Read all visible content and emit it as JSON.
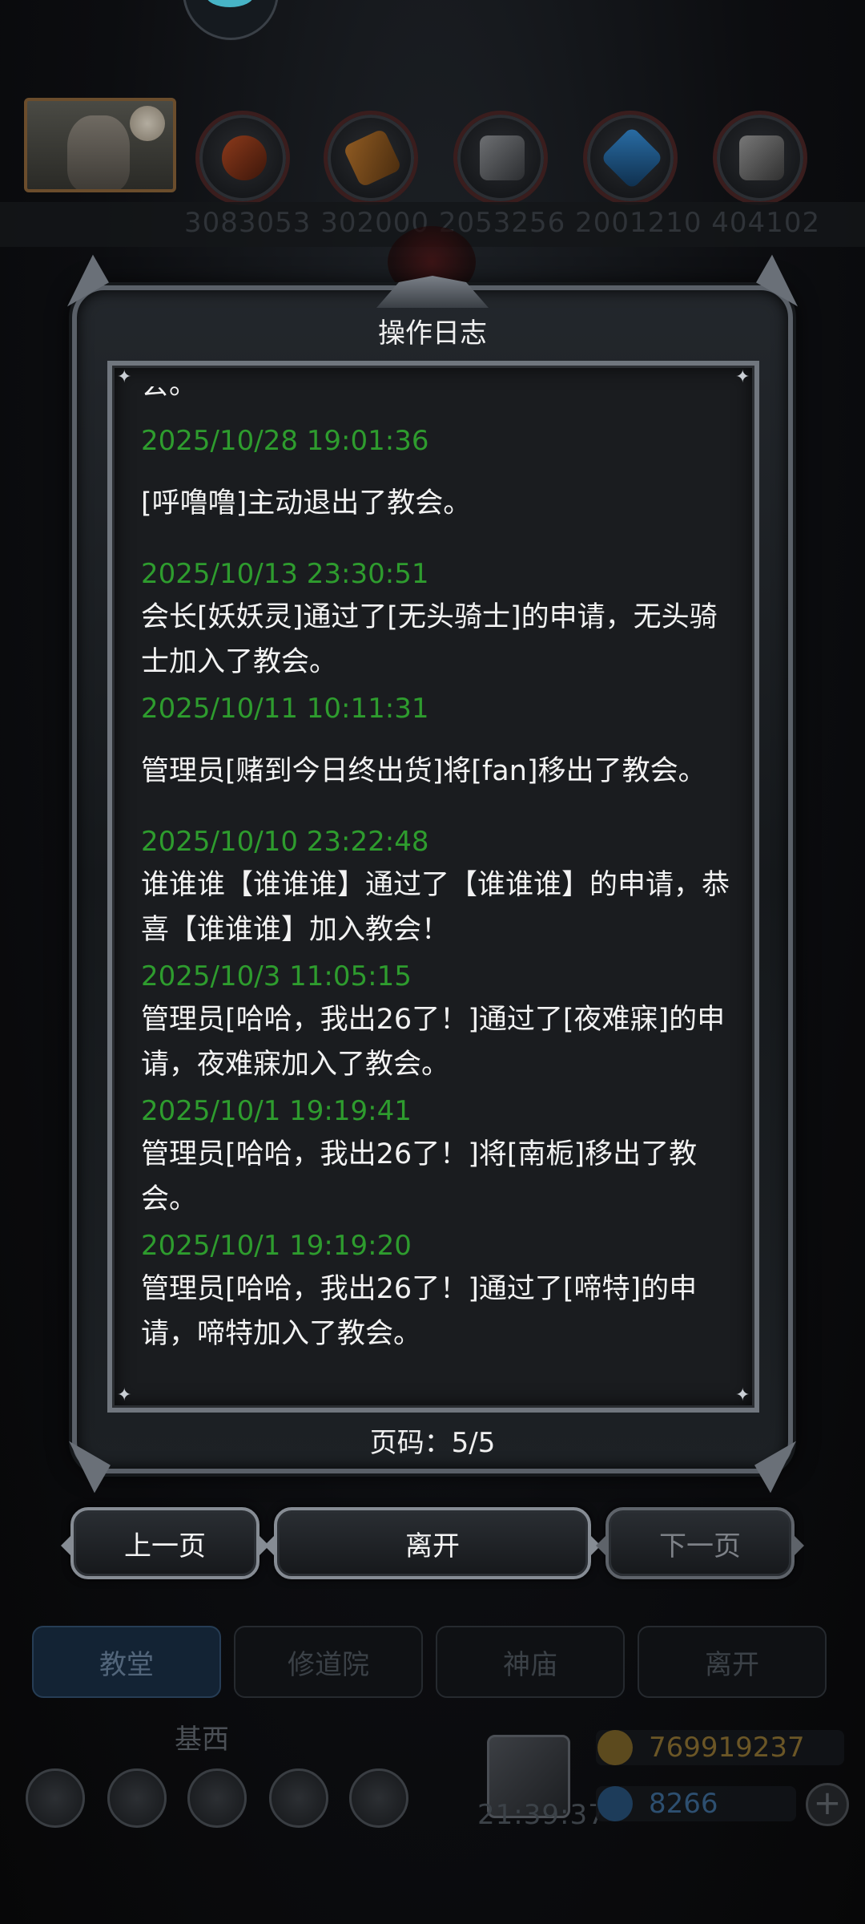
{
  "background": {
    "resource_strip_text": "3083053  302000  2053256  2001210  404102",
    "tabs": [
      {
        "label": "教堂"
      },
      {
        "label": "修道院"
      },
      {
        "label": "神庙"
      },
      {
        "label": "离开"
      }
    ],
    "player_name": "基西",
    "clock": "21:39:37",
    "gold": "769919237",
    "gems": "8266",
    "colors": {
      "gold": "#d4a62a",
      "gem": "#3e86c8"
    }
  },
  "dialog": {
    "title": "操作日志",
    "entries": [
      {
        "time": "",
        "text": "会。"
      },
      {
        "time": "2025/10/28 19:01:36",
        "text": "[呼噜噜]主动退出了教会。"
      },
      {
        "time": "2025/10/13 23:30:51",
        "text": "会长[妖妖灵]通过了[无头骑士]的申请，无头骑士加入了教会。"
      },
      {
        "time": "2025/10/11 10:11:31",
        "text": "管理员[赌到今日终出货]将[fan]移出了教会。"
      },
      {
        "time": "2025/10/10 23:22:48",
        "text": "谁谁谁【谁谁谁】通过了【谁谁谁】的申请，恭喜【谁谁谁】加入教会！"
      },
      {
        "time": "2025/10/3 11:05:15",
        "text": "管理员[哈哈，我出26了！]通过了[夜难寐]的申请，夜难寐加入了教会。"
      },
      {
        "time": "2025/10/1 19:19:41",
        "text": "管理员[哈哈，我出26了！]将[南栀]移出了教会。"
      },
      {
        "time": "2025/10/1 19:19:20",
        "text": "管理员[哈哈，我出26了！]通过了[啼特]的申请，啼特加入了教会。"
      }
    ],
    "page_label": "页码：5/5",
    "buttons": {
      "prev": "上一页",
      "leave": "离开",
      "next": "下一页"
    },
    "colors": {
      "timestamp": "#2e9c2e",
      "text": "#f2f2f2"
    }
  }
}
